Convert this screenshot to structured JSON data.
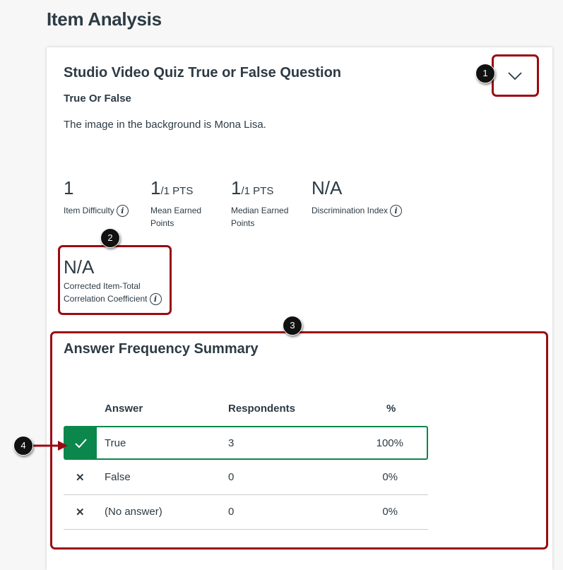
{
  "page_title": "Item Analysis",
  "question": {
    "title": "Studio Video Quiz True or False Question",
    "type": "True Or False",
    "description": "The image in the background is Mona Lisa."
  },
  "stats": [
    {
      "value": "1",
      "suffix": "",
      "label": "Item Difficulty",
      "info": true
    },
    {
      "value": "1",
      "suffix": "/1 PTS",
      "label": "Mean Earned Points",
      "info": false
    },
    {
      "value": "1",
      "suffix": "/1 PTS",
      "label": "Median Earned Points",
      "info": false
    },
    {
      "value": "N/A",
      "suffix": "",
      "label": "Discrimination Index",
      "info": true
    }
  ],
  "corrected": {
    "value": "N/A",
    "label1": "Corrected Item-Total",
    "label2": "Correlation Coefficient"
  },
  "summary": {
    "title": "Answer Frequency Summary",
    "headers": {
      "answer": "Answer",
      "respondents": "Respondents",
      "percent": "%"
    },
    "rows": [
      {
        "answer": "True",
        "respondents": "3",
        "percent": "100%",
        "correct": true
      },
      {
        "answer": "False",
        "respondents": "0",
        "percent": "0%",
        "correct": false
      },
      {
        "answer": "(No answer)",
        "respondents": "0",
        "percent": "0%",
        "correct": false
      }
    ]
  },
  "callouts": [
    "1",
    "2",
    "3",
    "4"
  ],
  "colors": {
    "correct": "#0b874b",
    "annotation": "#9b0a12",
    "text": "#2d3b45"
  }
}
